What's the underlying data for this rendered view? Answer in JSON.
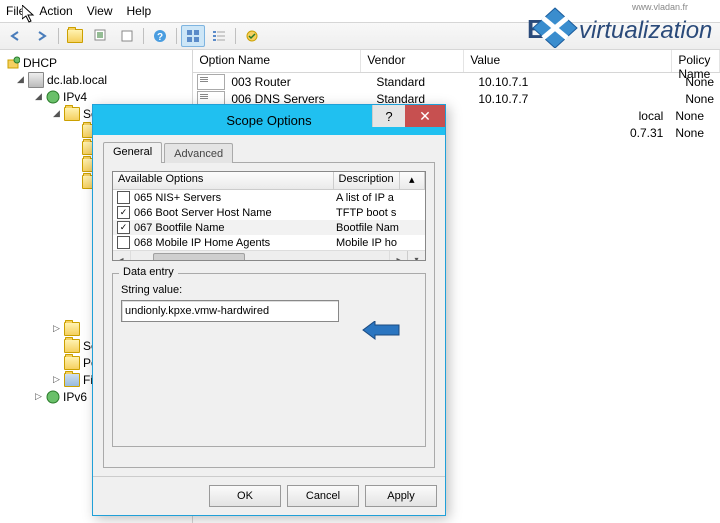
{
  "menu": {
    "file": "File",
    "action": "Action",
    "view": "View",
    "help": "Help"
  },
  "tree": {
    "root": "DHCP",
    "server": "dc.lab.local",
    "ipv4": "IPv4",
    "ipv6": "IPv6",
    "sc": "Sc",
    "so": "Se",
    "po": "Po",
    "fi": "Fil"
  },
  "list": {
    "headers": {
      "name": "Option Name",
      "vendor": "Vendor",
      "value": "Value",
      "policy": "Policy Name"
    },
    "rows": [
      {
        "name": "003 Router",
        "vendor": "Standard",
        "value": "10.10.7.1",
        "policy": "None"
      },
      {
        "name": "006 DNS Servers",
        "vendor": "Standard",
        "value": "10.10.7.7",
        "policy": "None"
      },
      {
        "name": "",
        "vendor": "",
        "value": "local",
        "policy": "None"
      },
      {
        "name": "",
        "vendor": "",
        "value": "0.7.31",
        "policy": "None"
      }
    ]
  },
  "dialog": {
    "title": "Scope Options",
    "tab_general": "General",
    "tab_advanced": "Advanced",
    "opt_header": {
      "a": "Available Options",
      "d": "Description"
    },
    "options": [
      {
        "chk": false,
        "label": "065 NIS+ Servers",
        "desc": "A list of IP a"
      },
      {
        "chk": true,
        "label": "066 Boot Server Host Name",
        "desc": "TFTP boot s"
      },
      {
        "chk": true,
        "label": "067 Bootfile Name",
        "desc": "Bootfile Nam"
      },
      {
        "chk": false,
        "label": "068 Mobile IP Home Agents",
        "desc": "Mobile IP ho"
      }
    ],
    "data_entry": "Data entry",
    "string_label": "String value:",
    "string_value": "undionly.kpxe.vmw-hardwired",
    "ok": "OK",
    "cancel": "Cancel",
    "apply": "Apply",
    "help": "?",
    "close": "✕"
  },
  "watermark": {
    "site": "www.vladan.fr",
    "brand_a": "ES",
    "brand_b": "virtualization"
  }
}
